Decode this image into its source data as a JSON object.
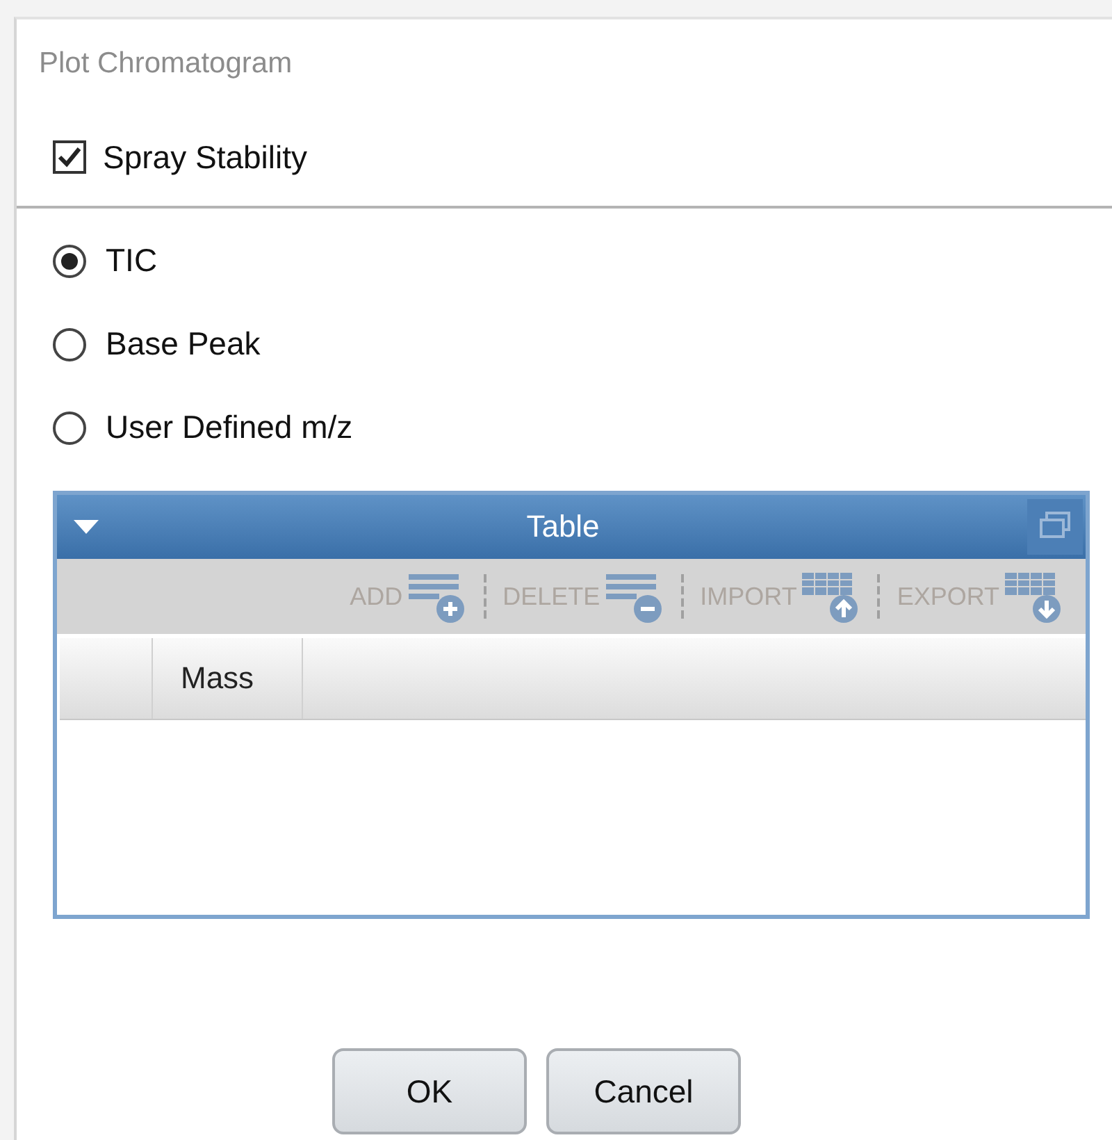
{
  "window": {
    "title": "Plot Chromatogram"
  },
  "spray_stability": {
    "label": "Spray Stability",
    "checked": true
  },
  "trace_options": [
    {
      "label": "TIC",
      "selected": true
    },
    {
      "label": "Base Peak",
      "selected": false
    },
    {
      "label": "User Defined m/z",
      "selected": false
    }
  ],
  "table_panel": {
    "title": "Table",
    "expanded": true,
    "toolbar": [
      {
        "label": "ADD",
        "kind": "add",
        "disabled": true
      },
      {
        "label": "DELETE",
        "kind": "delete",
        "disabled": true
      },
      {
        "label": "IMPORT",
        "kind": "import",
        "disabled": true
      },
      {
        "label": "EXPORT",
        "kind": "export",
        "disabled": true
      }
    ],
    "columns": [
      "Mass"
    ]
  },
  "buttons": [
    "OK",
    "Cancel"
  ]
}
